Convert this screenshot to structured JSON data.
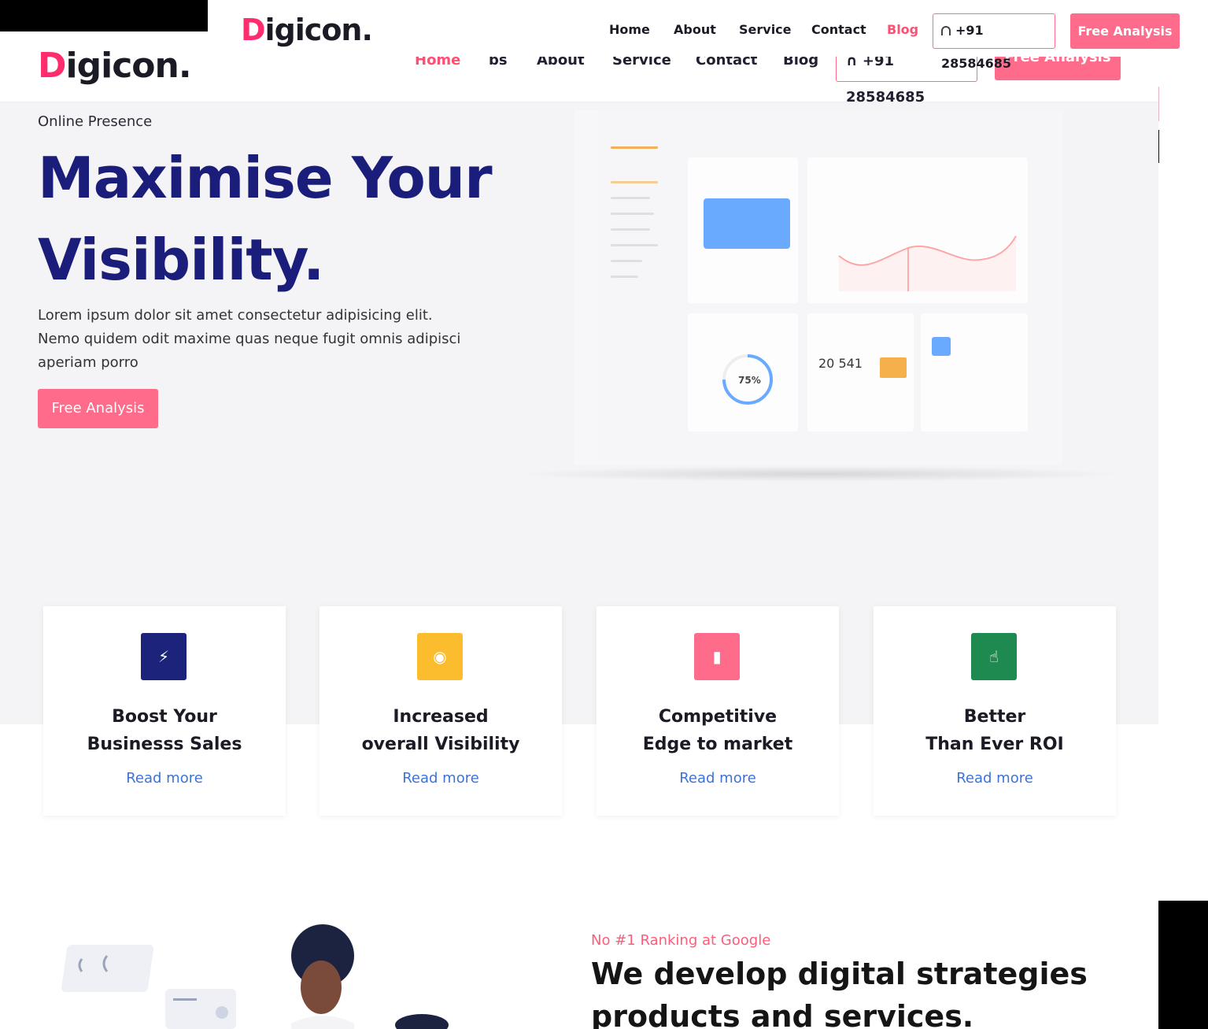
{
  "ghost_header": {
    "logo_first": "D",
    "logo_rest": "igicon.",
    "nav": [
      "Home",
      "bs",
      "About",
      "Service",
      "Contact",
      "Blog"
    ],
    "phone": "+91 28584685",
    "cta": "Free Analysis"
  },
  "header": {
    "logo_first": "D",
    "logo_rest": "igicon.",
    "nav": {
      "home": "Home",
      "about": "About",
      "service": "Service",
      "contact": "Contact",
      "blog": "Blog"
    },
    "phone": "+91 28584685",
    "cta": "Free Analysis"
  },
  "hero": {
    "eyebrow": "Online Presence",
    "title_line1": "Maximise Your",
    "title_line2": "Visibility.",
    "description": "Lorem ipsum dolor sit amet consectetur adipisicing elit. Nemo quidem odit maxime quas neque fugit omnis adipisci aperiam porro",
    "cta": "Free Analysis"
  },
  "dashboard": {
    "number": "20 541",
    "percent": "75%"
  },
  "features": [
    {
      "line1": "Boost Your",
      "line2": "Businesss Sales",
      "link": "Read more",
      "icon": "bolt-icon",
      "color": "#1b237a"
    },
    {
      "line1": "Increased",
      "line2": "overall Visibility",
      "link": "Read more",
      "icon": "eye-icon",
      "color": "#fbbd2e"
    },
    {
      "line1": "Competitive",
      "line2": "Edge to market",
      "link": "Read more",
      "icon": "bar-chart-icon",
      "color": "#ff6b8a"
    },
    {
      "line1": "Better",
      "line2": "Than Ever ROI",
      "link": "Read more",
      "icon": "hand-pointer-icon",
      "color": "#1e8a4f"
    }
  ],
  "section": {
    "eyebrow": "No #1 Ranking at Google",
    "title": "We develop digital strategies products and services."
  },
  "colors": {
    "accent": "#ff6b8a",
    "navy": "#1b1d7a",
    "link": "#3b73d9"
  }
}
